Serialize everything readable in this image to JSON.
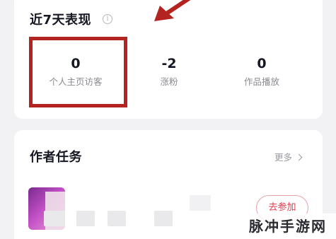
{
  "performance": {
    "title": "近7天表现",
    "info_icon": "info-circle-icon",
    "stats": [
      {
        "value": "0",
        "label": "个人主页访客"
      },
      {
        "value": "-2",
        "label": "涨粉"
      },
      {
        "value": "0",
        "label": "作品播放"
      }
    ],
    "highlight_color": "#b3231f"
  },
  "tasks": {
    "title": "作者任务",
    "more_label": "更多",
    "more_icon": "chevron-right-icon",
    "items": [
      {
        "action_label": "去参加"
      }
    ],
    "accent_color": "#e03d4c"
  },
  "watermark": {
    "text": "脉冲手游网"
  }
}
